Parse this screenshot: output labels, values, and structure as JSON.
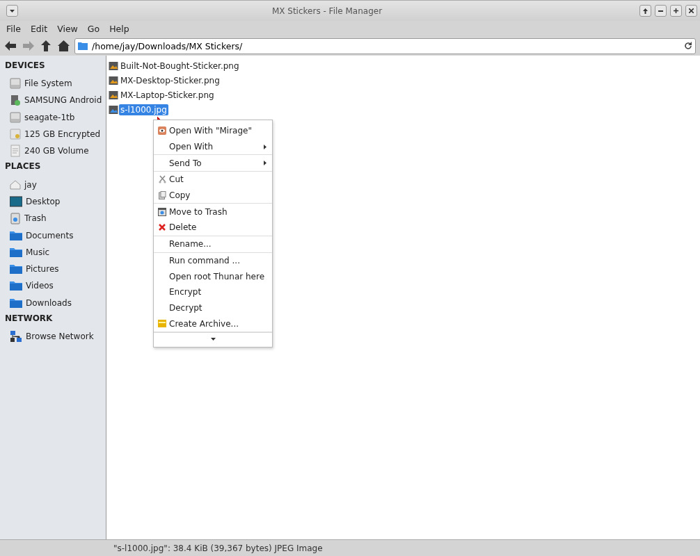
{
  "window": {
    "title": "MX Stickers - File Manager"
  },
  "menubar": [
    "File",
    "Edit",
    "View",
    "Go",
    "Help"
  ],
  "location": {
    "value": "/home/jay/Downloads/MX Stickers/"
  },
  "sidebar": [
    {
      "heading": "DEVICES",
      "items": [
        {
          "label": "File System",
          "kind": "drive"
        },
        {
          "label": "SAMSUNG Android",
          "kind": "phone"
        },
        {
          "label": "seagate-1tb",
          "kind": "drive"
        },
        {
          "label": "125 GB Encrypted",
          "kind": "locked"
        },
        {
          "label": "240 GB Volume",
          "kind": "volume"
        }
      ]
    },
    {
      "heading": "PLACES",
      "items": [
        {
          "label": "jay",
          "kind": "home"
        },
        {
          "label": "Desktop",
          "kind": "desktop"
        },
        {
          "label": "Trash",
          "kind": "trash"
        },
        {
          "label": "Documents",
          "kind": "folder"
        },
        {
          "label": "Music",
          "kind": "folder"
        },
        {
          "label": "Pictures",
          "kind": "folder"
        },
        {
          "label": "Videos",
          "kind": "folder"
        },
        {
          "label": "Downloads",
          "kind": "folder"
        }
      ]
    },
    {
      "heading": "NETWORK",
      "items": [
        {
          "label": "Browse Network",
          "kind": "network"
        }
      ]
    }
  ],
  "files": [
    {
      "name": "Built-Not-Bought-Sticker.png",
      "selected": false
    },
    {
      "name": "MX-Desktop-Sticker.png",
      "selected": false
    },
    {
      "name": "MX-Laptop-Sticker.png",
      "selected": false
    },
    {
      "name": "s-l1000.jpg",
      "selected": true
    }
  ],
  "context_menu": [
    [
      {
        "label": "Open With \"Mirage\"",
        "kind": "app",
        "submenu": false
      },
      {
        "label": "Open With",
        "kind": "plain",
        "submenu": true
      }
    ],
    [
      {
        "label": "Send To",
        "kind": "plain",
        "submenu": true
      }
    ],
    [
      {
        "label": "Cut",
        "kind": "cut",
        "submenu": false
      },
      {
        "label": "Copy",
        "kind": "copy",
        "submenu": false
      }
    ],
    [
      {
        "label": "Move to Trash",
        "kind": "trash",
        "submenu": false
      },
      {
        "label": "Delete",
        "kind": "delete",
        "submenu": false
      }
    ],
    [
      {
        "label": "Rename...",
        "kind": "plain",
        "submenu": false
      }
    ],
    [
      {
        "label": "Run command ...",
        "kind": "plain",
        "submenu": false
      },
      {
        "label": "Open root Thunar here",
        "kind": "plain",
        "submenu": false
      },
      {
        "label": "Encrypt",
        "kind": "plain",
        "submenu": false
      },
      {
        "label": "Decrypt",
        "kind": "plain",
        "submenu": false
      },
      {
        "label": "Create Archive...",
        "kind": "archive",
        "submenu": false
      }
    ]
  ],
  "status_bar": "\"s-l1000.jpg\": 38.4 KiB (39,367 bytes) JPEG Image"
}
